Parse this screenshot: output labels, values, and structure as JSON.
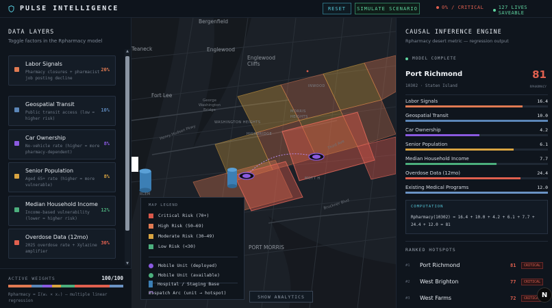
{
  "header": {
    "brand": "PULSE INTELLIGENCE",
    "reset": "RESET",
    "simulate": "SIMULATE SCENARIO",
    "critical": "0% / CRITICAL",
    "saveable": "127 LIVES SAVEABLE"
  },
  "left": {
    "title": "DATA LAYERS",
    "subtitle": "Toggle factors in the Rpharmacy model",
    "layers": [
      {
        "name": "Labor Signals",
        "desc": "Pharmacy closures + pharmacist job posting decline",
        "pct": "20%",
        "color": "#e07a52"
      },
      {
        "name": "Geospatial Transit",
        "desc": "Public transit access (low = higher risk)",
        "pct": "10%",
        "color": "#5b86b8"
      },
      {
        "name": "Car Ownership",
        "desc": "No-vehicle rate (higher = more pharmacy-dependent)",
        "pct": "8%",
        "color": "#8a5ae0"
      },
      {
        "name": "Senior Population",
        "desc": "Aged 65+ rate (higher = more vulnerable)",
        "pct": "8%",
        "color": "#d9a441"
      },
      {
        "name": "Median Household Income",
        "desc": "Income-based vulnerability (lower = higher risk)",
        "pct": "12%",
        "color": "#4caf7d"
      },
      {
        "name": "Overdose Data (12mo)",
        "desc": "2025 overdose rate + Xylazine amplifier",
        "pct": "30%",
        "color": "#e0604f"
      }
    ],
    "weights_label": "ACTIVE WEIGHTS",
    "weights_value": "100/100",
    "formula": "Rpharmacy = Σ(wᵢ × xᵢ) — multiple linear regression"
  },
  "map": {
    "labels": {
      "bergenfield": "Bergenfield",
      "teaneck": "Teaneck",
      "englewood": "Englewood",
      "englewood_cliffs": "Englewood Cliffs",
      "fort_lee": "Fort Lee",
      "gw_bridge": "George Washington Bridge",
      "inwood": "INWOOD",
      "morris": "MORRIS",
      "heights": "HEIGHTS",
      "highbridge": "HIGHBRIDGE",
      "port_morris": "PORT MORRIS",
      "harlem": "RLEM",
      "hhp": "Henry Hudson Pkwy",
      "third_ave": "Third Ave",
      "bruckner": "Bruckner Blvd",
      "mott": "Mott H",
      "hunts": "HUNTS POINT",
      "concourse": "CONCOURSE",
      "hudson_hts": "HUDSON HEIGHTS",
      "washington": "WASHINGTON HEIGHTS"
    },
    "legend": {
      "title": "MAP LEGEND",
      "risks": [
        {
          "label": "Critical Risk (70+)",
          "color": "#d9584a"
        },
        {
          "label": "High Risk (50–69)",
          "color": "#e07a52"
        },
        {
          "label": "Moderate Risk (30–49)",
          "color": "#d9a441"
        },
        {
          "label": "Low Risk (<30)",
          "color": "#4caf7d"
        }
      ],
      "mobile_deployed": "Mobile Unit (deployed)",
      "mobile_available": "Mobile Unit (available)",
      "hospital": "Hospital / Staging Base",
      "dispatch": "Dispatch Arc (unit → hotspot)"
    },
    "show_analytics": "SHOW ANALYTICS"
  },
  "right": {
    "title": "CAUSAL INFERENCE ENGINE",
    "subtitle": "Rpharmacy desert metric — regression output",
    "status": "MODEL COMPLETE",
    "location": "Port Richmond",
    "location_sub": "10302 · Staten Island",
    "score": "81",
    "score_label": "RPHARMACY",
    "factors": [
      {
        "name": "Labor Signals",
        "value": "16.4",
        "fill": 0.82,
        "color": "#e07a52"
      },
      {
        "name": "Geospatial Transit",
        "value": "10.0",
        "fill": 1.0,
        "color": "#5b86b8"
      },
      {
        "name": "Car Ownership",
        "value": "4.2",
        "fill": 0.52,
        "color": "#8a5ae0"
      },
      {
        "name": "Senior Population",
        "value": "6.1",
        "fill": 0.76,
        "color": "#d9a441"
      },
      {
        "name": "Median Household Income",
        "value": "7.7",
        "fill": 0.64,
        "color": "#4caf7d"
      },
      {
        "name": "Overdose Data (12mo)",
        "value": "24.4",
        "fill": 0.81,
        "color": "#e0604f"
      },
      {
        "name": "Existing Medical Programs",
        "value": "12.0",
        "fill": 1.0,
        "color": "#6a93c4"
      }
    ],
    "computation_title": "COMPUTATION",
    "computation": "Rpharmacy(10302) = 16.4 + 10.0 + 4.2 + 6.1 + 7.7 + 24.4 + 12.0 = 81",
    "hotspots_title": "RANKED HOTSPOTS",
    "hotspots": [
      {
        "rank": "#1",
        "name": "Port Richmond",
        "score": "81",
        "badge": "CRITICAL"
      },
      {
        "rank": "#2",
        "name": "West Brighton",
        "score": "77",
        "badge": "CRITICAL"
      },
      {
        "rank": "#3",
        "name": "West Farms",
        "score": "72",
        "badge": "CRITICAL"
      }
    ]
  },
  "colors": {
    "accent": "#55c7d8",
    "critical": "#e0604f",
    "good": "#5fd4a0"
  }
}
